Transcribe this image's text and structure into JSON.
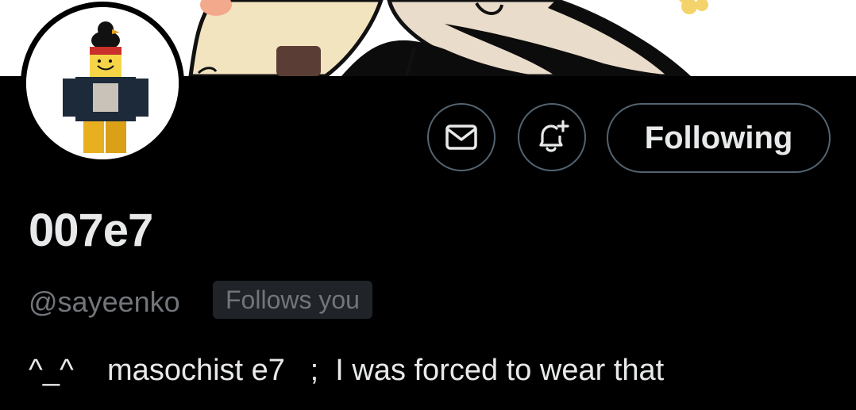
{
  "banner": {
    "image": "anime-illustration-banner"
  },
  "avatar": {
    "image": "roblox-character-avatar"
  },
  "actions": {
    "message_icon": "envelope-icon",
    "notify_icon": "bell-plus-icon",
    "following_label": "Following"
  },
  "profile": {
    "display_name": "007e7",
    "handle": "@sayeenko",
    "follows_you": "Follows you",
    "bio": "^_^    masochist e7   ;  I was forced to wear that"
  },
  "colors": {
    "background": "#000000",
    "text_primary": "#e7e9ea",
    "text_secondary": "#71767b",
    "border": "#536471",
    "badge_bg": "#202327"
  }
}
